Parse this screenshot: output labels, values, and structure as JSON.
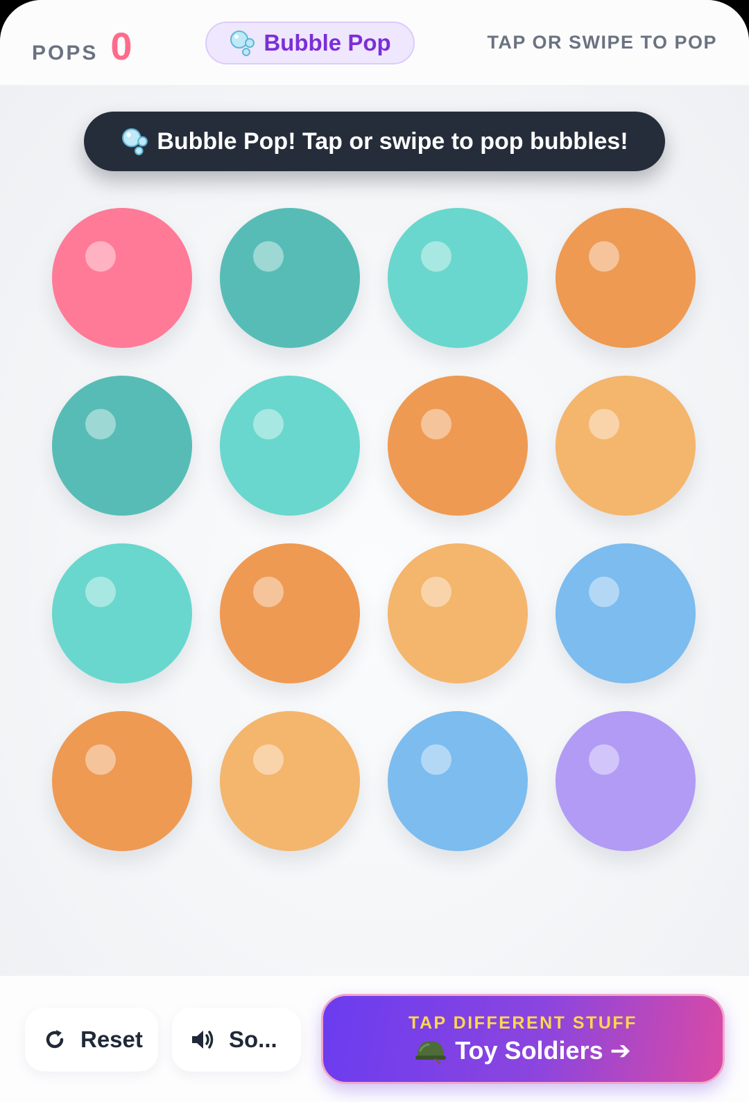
{
  "header": {
    "pops_label": "POPS",
    "pops_value": "0",
    "title": "Bubble Pop",
    "hint": "TAP OR SWIPE TO POP"
  },
  "banner": {
    "text": "Bubble Pop! Tap or swipe to pop bubbles!"
  },
  "bubbles": [
    {
      "color": "#ff7a96"
    },
    {
      "color": "#57bcb6"
    },
    {
      "color": "#69d7cd"
    },
    {
      "color": "#ee9a53"
    },
    {
      "color": "#57bcb6"
    },
    {
      "color": "#69d7cd"
    },
    {
      "color": "#ee9a53"
    },
    {
      "color": "#f4b56d"
    },
    {
      "color": "#69d7cd"
    },
    {
      "color": "#ee9a53"
    },
    {
      "color": "#f4b56d"
    },
    {
      "color": "#7cbcef"
    },
    {
      "color": "#ee9a53"
    },
    {
      "color": "#f4b56d"
    },
    {
      "color": "#7cbcef"
    },
    {
      "color": "#b19bf5"
    }
  ],
  "controls": {
    "reset_label": "Reset",
    "sound_label": "So..."
  },
  "next_game": {
    "subtitle": "TAP DIFFERENT STUFF",
    "label": "Toy Soldiers",
    "arrow": "➔"
  },
  "icons": {
    "title": "bubbles-icon",
    "banner": "bubbles-icon",
    "reset": "refresh-icon",
    "sound": "speaker-icon",
    "next": "helmet-icon"
  },
  "colors": {
    "pops_value": "#ff6b8a",
    "title_text": "#7b2fd6",
    "banner_bg": "#262d3a",
    "next_subtitle": "#ffd84d"
  }
}
